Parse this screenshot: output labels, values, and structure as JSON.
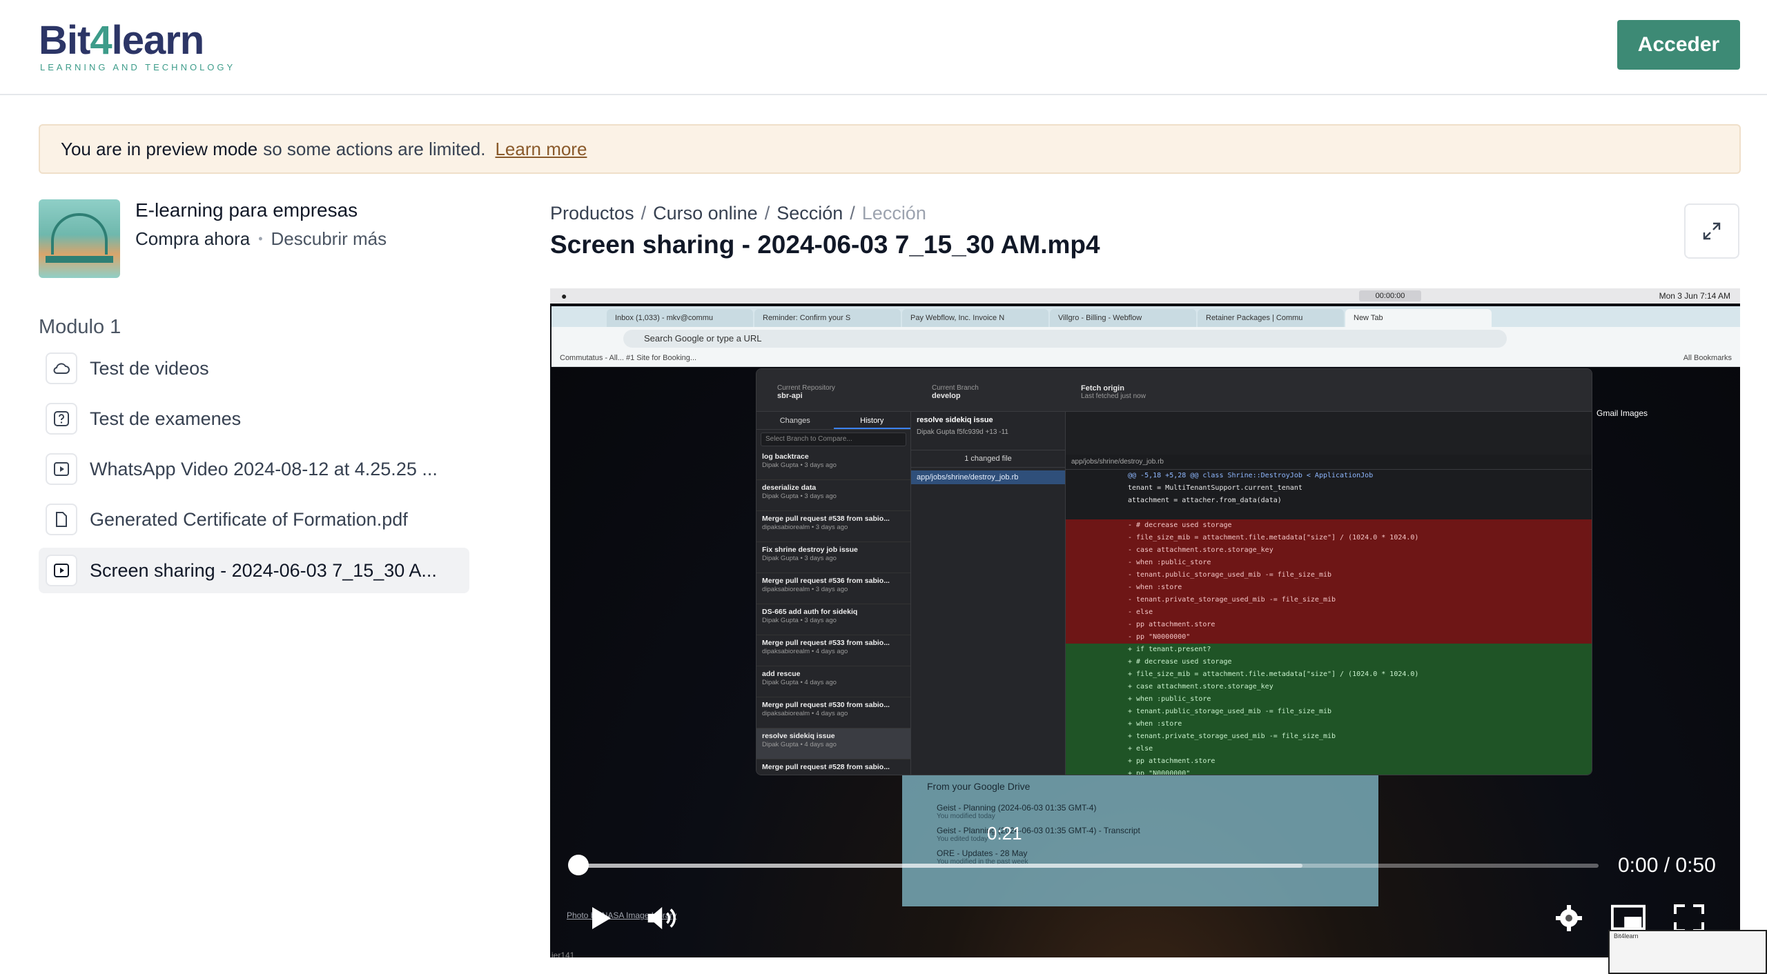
{
  "header": {
    "logo_main_a": "Bit",
    "logo_main_b": "4",
    "logo_main_c": "learn",
    "logo_sub": "LEARNING AND TECHNOLOGY",
    "login_label": "Acceder"
  },
  "banner": {
    "bold": "You are in preview mode",
    "rest": "so some actions are limited.",
    "link": "Learn more"
  },
  "course": {
    "title": "E-learning para empresas",
    "buy": "Compra ahora",
    "dot": "•",
    "discover": "Descubrir más"
  },
  "module": {
    "title": "Modulo 1",
    "lessons": [
      {
        "label": "Test de videos",
        "icon": "cloud-icon"
      },
      {
        "label": "Test de examenes",
        "icon": "question-icon"
      },
      {
        "label": "WhatsApp Video 2024-08-12 at 4.25.25 ...",
        "icon": "video-icon"
      },
      {
        "label": "Generated Certificate of Formation.pdf",
        "icon": "document-icon"
      },
      {
        "label": "Screen sharing - 2024-06-03 7_15_30 A...",
        "icon": "video-icon",
        "active": true
      }
    ]
  },
  "breadcrumb": {
    "items": [
      "Productos",
      "Curso online",
      "Sección",
      "Lección"
    ],
    "sep": "/"
  },
  "page_title": "Screen sharing - 2024-06-03 7_15_30 AM.mp4",
  "video": {
    "mac_timer": "00:00:00",
    "mac_clock": "Mon 3 Jun 7:14 AM",
    "browser_tabs": [
      "Inbox (1,033) - mkv@commu",
      "Reminder: Confirm your S",
      "Pay Webflow, Inc. Invoice N",
      "Villgro - Billing - Webflow",
      "Retainer Packages | Commu",
      "New Tab"
    ],
    "url_placeholder": "Search Google or type a URL",
    "bookmarks_left": "Commutatus - All...    #1 Site for Booking...",
    "bookmarks_right": "All Bookmarks",
    "google_links": "Gmail   Images",
    "git": {
      "repo_label": "Current Repository",
      "repo": "sbr-api",
      "branch_label": "Current Branch",
      "branch": "develop",
      "fetch": "Fetch origin",
      "fetch_sub": "Last fetched just now",
      "tab_changes": "Changes",
      "tab_history": "History",
      "filter": "Select Branch to Compare...",
      "commits": [
        {
          "title": "log backtrace",
          "meta": "Dipak Gupta • 3 days ago"
        },
        {
          "title": "deserialize data",
          "meta": "Dipak Gupta • 3 days ago"
        },
        {
          "title": "Merge pull request #538 from sabio...",
          "meta": "dipaksabiorealm • 3 days ago"
        },
        {
          "title": "Fix shrine destroy job issue",
          "meta": "Dipak Gupta • 3 days ago"
        },
        {
          "title": "Merge pull request #536 from sabio...",
          "meta": "dipaksabiorealm • 3 days ago"
        },
        {
          "title": "DS-665 add auth for sidekiq",
          "meta": "Dipak Gupta • 3 days ago"
        },
        {
          "title": "Merge pull request #533 from sabio...",
          "meta": "dipaksabiorealm • 4 days ago"
        },
        {
          "title": "add rescue",
          "meta": "Dipak Gupta • 4 days ago"
        },
        {
          "title": "Merge pull request #530 from sabio...",
          "meta": "dipaksabiorealm • 4 days ago"
        },
        {
          "title": "resolve sidekiq issue",
          "meta": "Dipak Gupta • 4 days ago",
          "selected": true
        },
        {
          "title": "Merge pull request #528 from sabio...",
          "meta": ""
        }
      ],
      "commit_title": "resolve sidekiq issue",
      "commit_meta": "Dipak Gupta  f5fc939d  +13 -11",
      "changed_files": "1 changed file",
      "file": "app/jobs/shrine/destroy_job.rb",
      "diff_path": "app/jobs/shrine/destroy_job.rb",
      "diff": [
        {
          "t": "ctx",
          "s": "@@ -5,18 +5,28 @@ class Shrine::DestroyJob < ApplicationJob"
        },
        {
          "t": "n",
          "s": "  tenant = MultiTenantSupport.current_tenant"
        },
        {
          "t": "n",
          "s": "  attachment = attacher.from_data(data)"
        },
        {
          "t": "n",
          "s": ""
        },
        {
          "t": "del",
          "s": "-  # decrease used storage"
        },
        {
          "t": "del",
          "s": "-  file_size_mib = attachment.file.metadata[\"size\"] / (1024.0 * 1024.0)"
        },
        {
          "t": "del",
          "s": "-  case attachment.store.storage_key"
        },
        {
          "t": "del",
          "s": "-  when :public_store"
        },
        {
          "t": "del",
          "s": "-    tenant.public_storage_used_mib -= file_size_mib"
        },
        {
          "t": "del",
          "s": "-  when :store"
        },
        {
          "t": "del",
          "s": "-    tenant.private_storage_used_mib -= file_size_mib"
        },
        {
          "t": "del",
          "s": "-  else"
        },
        {
          "t": "del",
          "s": "-    pp attachment.store"
        },
        {
          "t": "del",
          "s": "-    pp \"N0000000\""
        },
        {
          "t": "add",
          "s": "+  if tenant.present?"
        },
        {
          "t": "add",
          "s": "+    # decrease used storage"
        },
        {
          "t": "add",
          "s": "+    file_size_mib = attachment.file.metadata[\"size\"] / (1024.0 * 1024.0)"
        },
        {
          "t": "add",
          "s": "+    case attachment.store.storage_key"
        },
        {
          "t": "add",
          "s": "+    when :public_store"
        },
        {
          "t": "add",
          "s": "+      tenant.public_storage_used_mib -= file_size_mib"
        },
        {
          "t": "add",
          "s": "+    when :store"
        },
        {
          "t": "add",
          "s": "+      tenant.private_storage_used_mib -= file_size_mib"
        },
        {
          "t": "add",
          "s": "+    else"
        },
        {
          "t": "add",
          "s": "+      pp attachment.store"
        },
        {
          "t": "add",
          "s": "+      pp \"N0000000\""
        }
      ]
    },
    "drive": {
      "title": "From your Google Drive",
      "items": [
        {
          "title": "Geist - Planning (2024-06-03 01:35 GMT-4)",
          "sub": "You modified today"
        },
        {
          "title": "Geist - Planning (2024-06-03 01:35 GMT-4) - Transcript",
          "sub": "You edited today"
        },
        {
          "title": "ORE - Updates - 28 May",
          "sub": "You modified in the past week"
        }
      ]
    },
    "photo_credit": "Photo by NASA Image Library",
    "corner_text": "ier141",
    "hover_time": "0:21",
    "time_display": "0:00 / 0:50",
    "progress": 0.0,
    "buffered": 0.71,
    "pip_title": "Bit4learn"
  },
  "colors": {
    "brand": "#2c3566",
    "accent": "#3d8a75",
    "banner_bg": "#fbf2e6",
    "link": "#8a5a2b"
  }
}
